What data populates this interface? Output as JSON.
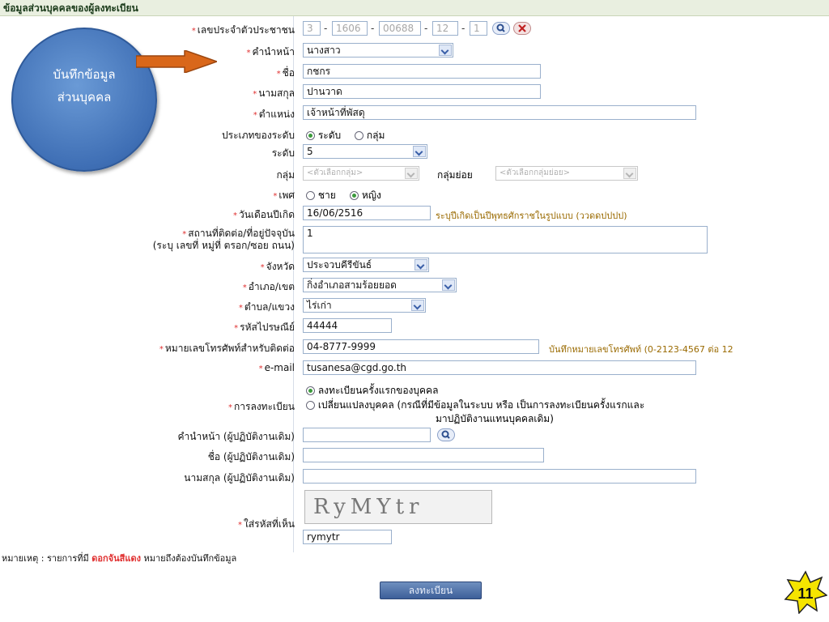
{
  "header": {
    "title": "ข้อมูลส่วนบุคคลของผู้ลงทะเบียน"
  },
  "callout": {
    "line1": "บันทึกข้อมูล",
    "line2": "ส่วนบุคคล"
  },
  "fields": {
    "id_label": "เลขประจำตัวประชาชน",
    "id_parts": [
      "3",
      "1606",
      "00688",
      "12",
      "1"
    ],
    "prefix_label": "คำนำหน้า",
    "prefix_value": "นางสาว",
    "firstname_label": "ชื่อ",
    "firstname_value": "กชกร",
    "lastname_label": "นามสกุล",
    "lastname_value": "ปานวาด",
    "position_label": "ตำแหน่ง",
    "position_value": "เจ้าหน้าที่พัสดุ",
    "leveltype_label": "ประเภทของระดับ",
    "leveltype_opt1": "ระดับ",
    "leveltype_opt2": "กลุ่ม",
    "level_label": "ระดับ",
    "level_value": "5",
    "group_label": "กลุ่ม",
    "group_value": "<ตัวเลือกกลุ่ม>",
    "subgroup_label": "กลุ่มย่อย",
    "subgroup_value": "<ตัวเลือกกลุ่มย่อย>",
    "gender_label": "เพศ",
    "gender_male": "ชาย",
    "gender_female": "หญิง",
    "dob_label": "วันเดือนปีเกิด",
    "dob_value": "16/06/2516",
    "dob_note": "ระบุปีเกิดเป็นปีพุทธศักราชในรูปแบบ (ววดดปปปป)",
    "address_label1": "สถานที่ติดต่อ/ที่อยู่ปัจจุบัน",
    "address_label2": "(ระบุ เลขที่ หมู่ที่ ตรอก/ซอย ถนน)",
    "address_value": "1",
    "province_label": "จังหวัด",
    "province_value": "ประจวบคีรีขันธ์",
    "district_label": "อำเภอ/เขต",
    "district_value": "กิ่งอำเภอสามร้อยยอด",
    "subdistrict_label": "ตำบล/แขวง",
    "subdistrict_value": "ไร่เก่า",
    "postal_label": "รหัสไปรษณีย์",
    "postal_value": "44444",
    "phone_label": "หมายเลขโทรศัพท์สำหรับติดต่อ",
    "phone_value": "04-8777-9999",
    "phone_note": "บันทึกหมายเลขโทรศัพท์ (0-2123-4567 ต่อ 12",
    "email_label": "e-mail",
    "email_value": "tusanesa@cgd.go.th",
    "reg_label": "การลงทะเบียน",
    "reg_opt1": "ลงทะเบียนครั้งแรกของบุคคล",
    "reg_opt2_line1": "เปลี่ยนแปลงบุคคล (กรณีที่มีข้อมูลในระบบ หรือ เป็นการลงทะเบียนครั้งแรกและ",
    "reg_opt2_line2": "มาปฏิบัติงานแทนบุคคลเดิม)",
    "prev_prefix_label": "คำนำหน้า (ผู้ปฏิบัติงานเดิม)",
    "prev_name_label": "ชื่อ (ผู้ปฏิบัติงานเดิม)",
    "prev_lastname_label": "นามสกุล (ผู้ปฏิบัติงานเดิม)",
    "captcha_label": "ใส่รหัสที่เห็น",
    "captcha_image_text": "RyMYtr",
    "captcha_value": "rymytr"
  },
  "footnote": {
    "prefix": "หมายเหตุ : รายการที่มี",
    "highlight": "ดอกจันสีแดง",
    "suffix": "หมายถึงต้องบันทึกข้อมูล"
  },
  "submit_label": "ลงทะเบียน",
  "slide_number": "11",
  "colors": {
    "header_bg": "#e9efe0",
    "required": "#e03030",
    "bubble": "#3f6fb5",
    "arrow": "#d9671a",
    "star": "#f5e400"
  }
}
